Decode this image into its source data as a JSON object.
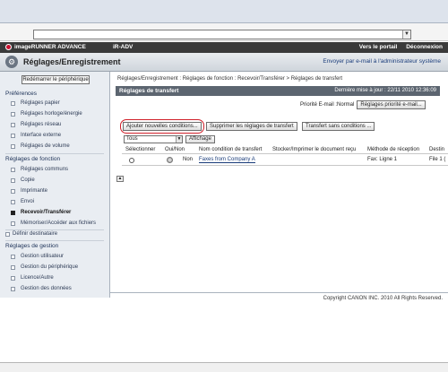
{
  "header": {
    "brand": "imageRUNNER ADVANCE",
    "device": "iR-ADV",
    "links": [
      "Vers le portail",
      "Déconnexion"
    ]
  },
  "title_bar": {
    "title": "Réglages/Enregistrement",
    "admin_link": "Envoyer par e-mail à l'administrateur système"
  },
  "sidebar": {
    "restart_button": "Redémarrer le périphérique",
    "preferences": {
      "label": "Préférences",
      "items": [
        "Réglages papier",
        "Réglages horloge/énergie",
        "Réglages réseau",
        "Interface externe",
        "Réglages de volume"
      ]
    },
    "functions": {
      "label": "Réglages de fonction",
      "items": [
        "Réglages communs",
        "Copie",
        "Imprimante",
        "Envoi",
        "Recevoir/Transférer",
        "Mémoriser/Accéder aux fichiers"
      ]
    },
    "destination": "Définir destinataire",
    "management": {
      "label": "Réglages de gestion",
      "items": [
        "Gestion utilisateur",
        "Gestion du périphérique",
        "Licence/Autre",
        "Gestion des données"
      ]
    }
  },
  "main": {
    "breadcrumb": "Réglages/Enregistrement : Réglages de fonction : Recevoir/Transférer > Réglages de transfert",
    "panel_title": "Réglages de transfert",
    "last_update": "Dernière mise à jour : 22/11 2010 12:36:09",
    "priority_label": "Priorité E-mail : ",
    "priority_value": "Normal",
    "priority_button": "Réglages priorité e-mail...",
    "add_button": "Ajouter nouvelles conditions...",
    "delete_button": "Supprimer les réglages de transfert",
    "unconditional_button": "Transfert sans conditions ...",
    "filter_value": "Tous",
    "display_button": "Affichage",
    "columns": [
      "Sélectionner",
      "Oui/Non",
      "Nom condition de transfert",
      "Stocker/Imprimer le document reçu",
      "Méthode de réception",
      "Destin"
    ],
    "rows": [
      {
        "enabled": "Non",
        "name": "Faxes from Company A",
        "method": "Fax: Ligne 1",
        "destination": "File 1 ("
      }
    ]
  },
  "footer": {
    "copyright": "Copyright CANON INC. 2010 All Rights Reserved."
  }
}
